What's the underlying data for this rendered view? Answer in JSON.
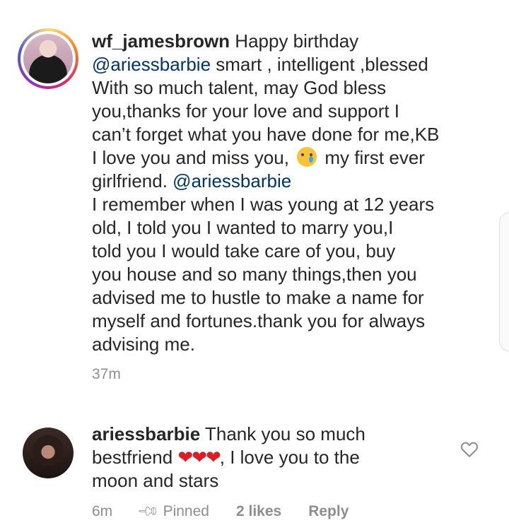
{
  "comments": [
    {
      "username": "wf_jamesbrown",
      "lines": [
        {
          "a": "Happy birthday"
        },
        {
          "mention": "@ariessbarbie",
          "rest": " smart , intelligent ,blessed"
        },
        {
          "text": "With so much talent, may God bless"
        },
        {
          "text": "you,thanks for your love and support I"
        },
        {
          "text": "can’t forget what you have done for me,KB"
        },
        {
          "pre": "I love you and miss you,",
          "post": " my first ever"
        },
        {
          "text": "girlfriend. ",
          "mention": "@ariessbarbie"
        },
        {
          "text": "I remember when I was young at 12 years"
        },
        {
          "text": "old, I told you I wanted to marry you,I"
        },
        {
          "text": "told you I would take care of you, buy"
        },
        {
          "text": "you house and so many things,then you"
        },
        {
          "text": "advised me to hustle to make a name for"
        },
        {
          "text": "myself and fortunes.thank you for always"
        },
        {
          "text": "advising me."
        }
      ],
      "emoji_icon": "crying-face-emoji",
      "time": "37m"
    },
    {
      "username": "ariessbarbie",
      "line1_rest": "Thank you so much",
      "line2_pre": "bestfriend ",
      "hearts": "❤❤❤",
      "line2_post": ", I love you to the",
      "line3": "moon and stars",
      "time": "6m",
      "pinned_label": "Pinned",
      "likes_label": "2 likes",
      "reply_label": "Reply",
      "like_icon": "heart-outline-icon"
    }
  ],
  "colors": {
    "mention": "#003569",
    "meta": "#8e8e8e",
    "heart_red": "#d91f26"
  }
}
